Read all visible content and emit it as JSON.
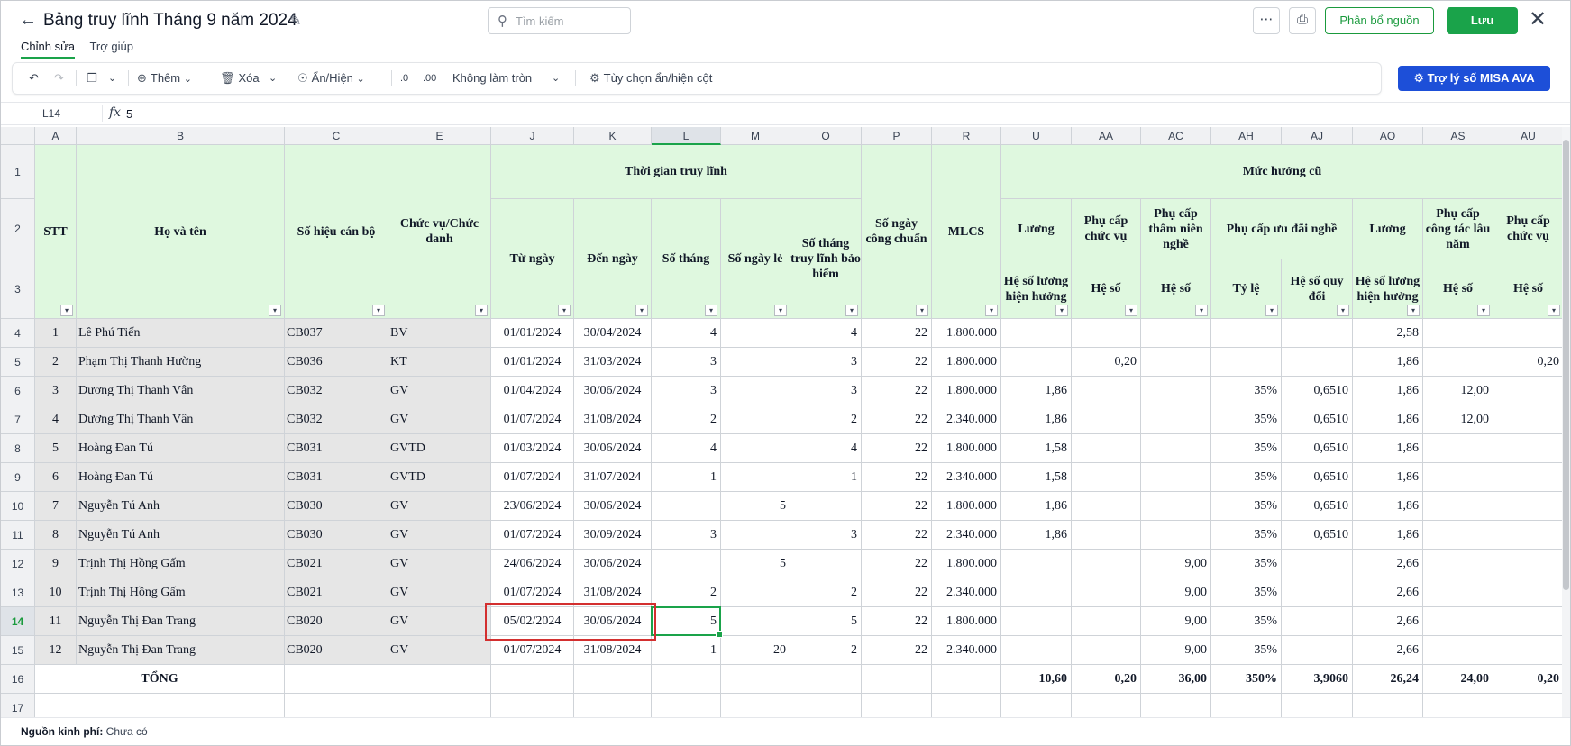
{
  "header": {
    "title": "Bảng truy lĩnh Tháng 9 năm 2024",
    "search_placeholder": "Tìm kiếm",
    "allocate_label": "Phân bổ nguồn",
    "save_label": "Lưu"
  },
  "tabs": [
    {
      "label": "Chỉnh sửa"
    },
    {
      "label": "Trợ giúp"
    }
  ],
  "toolbar": {
    "add_label": "Thêm",
    "delete_label": "Xóa",
    "showhide_label": "Ẩn/Hiện",
    "dec_less": ".0",
    "dec_more": ".00",
    "rounding_label": "Không làm tròn",
    "column_options_label": "Tùy chọn ẩn/hiện cột",
    "ava_label": "Trợ lý số MISA AVA"
  },
  "formula_bar": {
    "cell_ref": "L14",
    "fx": "fx",
    "value": "5"
  },
  "columns": [
    "A",
    "B",
    "C",
    "E",
    "J",
    "K",
    "L",
    "M",
    "O",
    "P",
    "R",
    "U",
    "AA",
    "AC",
    "AH",
    "AJ",
    "AO",
    "AS",
    "AU"
  ],
  "row_numbers": [
    "1",
    "2",
    "3",
    "4",
    "5",
    "6",
    "7",
    "8",
    "9",
    "10",
    "11",
    "12",
    "13",
    "14",
    "15",
    "16",
    "17"
  ],
  "headers": {
    "stt": "STT",
    "ho_ten": "Họ và tên",
    "so_hieu": "Số hiệu cán bộ",
    "chuc_vu": "Chức vụ/Chức danh",
    "thoi_gian": "Thời gian truy lĩnh",
    "tu_ngay": "Từ ngày",
    "den_ngay": "Đến ngày",
    "so_thang": "Số tháng",
    "so_ngay_le": "Số ngày lẻ",
    "so_thang_bh": "Số tháng truy lĩnh bảo hiểm",
    "so_ngay_cong": "Số ngày công chuẩn",
    "mlcs": "MLCS",
    "muc_huong_cu": "Mức hưởng cũ",
    "luong": "Lương",
    "pc_chuc_vu": "Phụ cấp chức vụ",
    "pc_tham_nien": "Phụ cấp thâm niên nghề",
    "pc_uu_dai": "Phụ cấp ưu đãi nghề",
    "luong2": "Lương",
    "pc_cong_tac": "Phụ cấp công tác lâu năm",
    "pc_chuc_vu2": "Phụ cấp chức vụ",
    "he_so_luong": "Hệ số lương hiện hưởng",
    "he_so": "Hệ số",
    "he_so_tn": "Hệ số",
    "ty_le": "Tỷ lệ",
    "he_so_quy_doi": "Hệ số quy đổi",
    "he_so_luong2": "Hệ số lương hiện hưởng",
    "he_so_ct": "Hệ số",
    "he_so_cv2": "Hệ số"
  },
  "rows": [
    [
      "1",
      "Lê Phú Tiến",
      "CB037",
      "BV",
      "01/01/2024",
      "30/04/2024",
      "4",
      "",
      "4",
      "22",
      "1.800.000",
      "",
      "",
      "",
      "",
      "",
      "2,58",
      "",
      ""
    ],
    [
      "2",
      "Phạm Thị Thanh  Hường",
      "CB036",
      "KT",
      "01/01/2024",
      "31/03/2024",
      "3",
      "",
      "3",
      "22",
      "1.800.000",
      "",
      "0,20",
      "",
      "",
      "",
      "1,86",
      "",
      "0,20"
    ],
    [
      "3",
      "Dương Thị Thanh Vân",
      "CB032",
      "GV",
      "01/04/2024",
      "30/06/2024",
      "3",
      "",
      "3",
      "22",
      "1.800.000",
      "1,86",
      "",
      "",
      "35%",
      "0,6510",
      "1,86",
      "12,00",
      ""
    ],
    [
      "4",
      "Dương Thị Thanh Vân",
      "CB032",
      "GV",
      "01/07/2024",
      "31/08/2024",
      "2",
      "",
      "2",
      "22",
      "2.340.000",
      "1,86",
      "",
      "",
      "35%",
      "0,6510",
      "1,86",
      "12,00",
      ""
    ],
    [
      "5",
      "Hoàng Đan Tú",
      "CB031",
      "GVTD",
      "01/03/2024",
      "30/06/2024",
      "4",
      "",
      "4",
      "22",
      "1.800.000",
      "1,58",
      "",
      "",
      "35%",
      "0,6510",
      "1,86",
      "",
      ""
    ],
    [
      "6",
      "Hoàng Đan Tú",
      "CB031",
      "GVTD",
      "01/07/2024",
      "31/07/2024",
      "1",
      "",
      "1",
      "22",
      "2.340.000",
      "1,58",
      "",
      "",
      "35%",
      "0,6510",
      "1,86",
      "",
      ""
    ],
    [
      "7",
      "Nguyễn Tú Anh",
      "CB030",
      "GV",
      "23/06/2024",
      "30/06/2024",
      "",
      "5",
      "",
      "22",
      "1.800.000",
      "1,86",
      "",
      "",
      "35%",
      "0,6510",
      "1,86",
      "",
      ""
    ],
    [
      "8",
      "Nguyễn Tú Anh",
      "CB030",
      "GV",
      "01/07/2024",
      "30/09/2024",
      "3",
      "",
      "3",
      "22",
      "2.340.000",
      "1,86",
      "",
      "",
      "35%",
      "0,6510",
      "1,86",
      "",
      ""
    ],
    [
      "9",
      "Trịnh Thị Hồng Gấm",
      "CB021",
      "GV",
      "24/06/2024",
      "30/06/2024",
      "",
      "5",
      "",
      "22",
      "1.800.000",
      "",
      "",
      "9,00",
      "35%",
      "",
      "2,66",
      "",
      ""
    ],
    [
      "10",
      "Trịnh Thị Hồng Gấm",
      "CB021",
      "GV",
      "01/07/2024",
      "31/08/2024",
      "2",
      "",
      "2",
      "22",
      "2.340.000",
      "",
      "",
      "9,00",
      "35%",
      "",
      "2,66",
      "",
      ""
    ],
    [
      "11",
      "Nguyễn Thị  Đan Trang",
      "CB020",
      "GV",
      "05/02/2024",
      "30/06/2024",
      "5",
      "",
      "5",
      "22",
      "1.800.000",
      "",
      "",
      "9,00",
      "35%",
      "",
      "2,66",
      "",
      ""
    ],
    [
      "12",
      "Nguyễn Thị  Đan Trang",
      "CB020",
      "GV",
      "01/07/2024",
      "31/08/2024",
      "1",
      "20",
      "2",
      "22",
      "2.340.000",
      "",
      "",
      "9,00",
      "35%",
      "",
      "2,66",
      "",
      ""
    ]
  ],
  "total": {
    "label": "TỔNG",
    "values": [
      "10,60",
      "0,20",
      "36,00",
      "350%",
      "3,9060",
      "26,24",
      "24,00",
      "0,20"
    ]
  },
  "footer": {
    "label": "Nguồn kinh phí:",
    "value": "Chưa có"
  }
}
